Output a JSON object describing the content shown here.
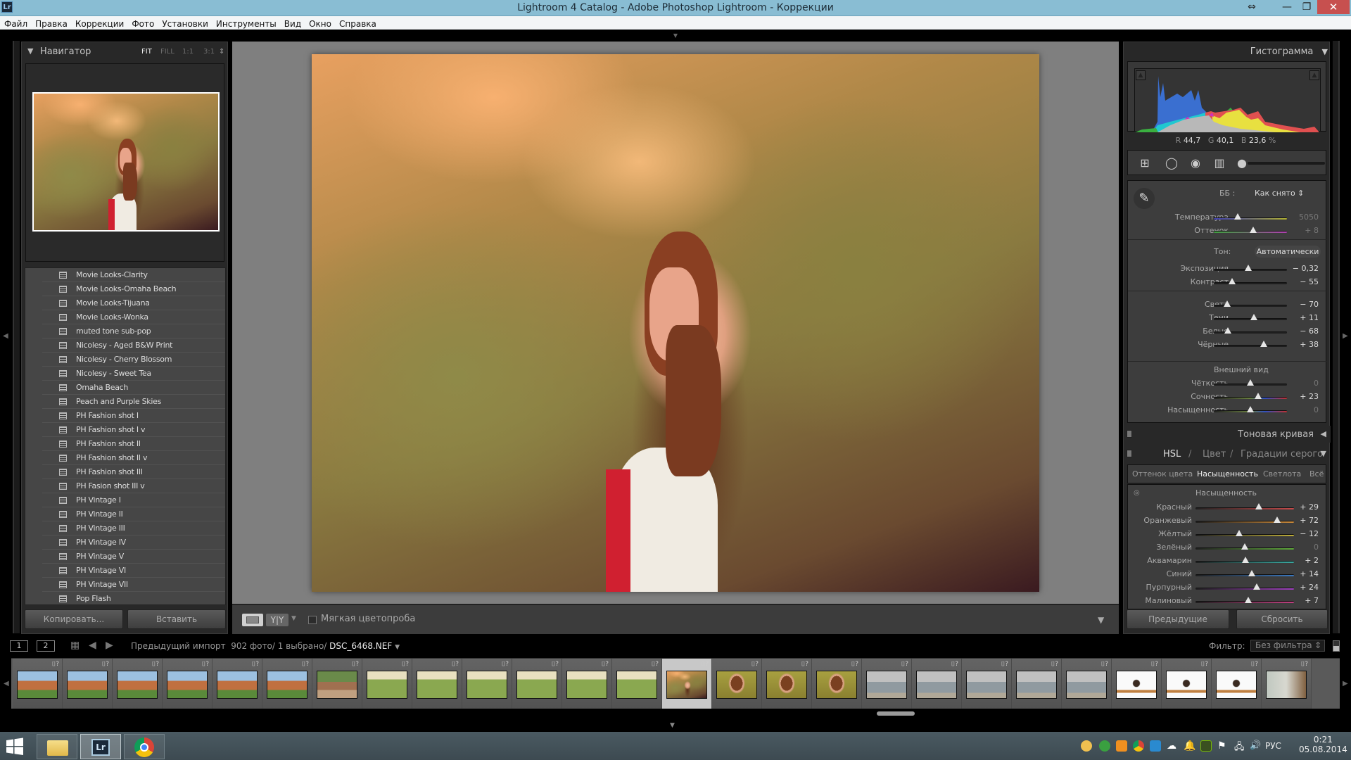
{
  "window": {
    "title": "Lightroom 4 Catalog - Adobe Photoshop Lightroom - Коррекции",
    "app_icon": "Lr",
    "controls": [
      "resize-icon",
      "minimize-icon",
      "maximize-icon",
      "close-icon"
    ],
    "control_glyphs": [
      "⇔",
      "—",
      "❐",
      "✕"
    ]
  },
  "menu": [
    "Файл",
    "Правка",
    "Коррекции",
    "Фото",
    "Установки",
    "Инструменты",
    "Вид",
    "Окно",
    "Справка"
  ],
  "navigator": {
    "title": "Навигатор",
    "zoom_options": [
      "FIT",
      "FILL",
      "1:1",
      "3:1"
    ],
    "active_zoom": "FIT"
  },
  "presets": [
    "Movie Looks-Clarity",
    "Movie Looks-Omaha Beach",
    "Movie Looks-Tijuana",
    "Movie Looks-Wonka",
    "muted tone sub-pop",
    "Nicolesy - Aged B&W Print",
    "Nicolesy - Cherry Blossom",
    "Nicolesy - Sweet Tea",
    "Omaha Beach",
    "Peach and Purple Skies",
    "PH Fashion shot I",
    "PH Fashion shot I v",
    "PH Fashion shot II",
    "PH Fashion shot II v",
    "PH Fashion shot III",
    "PH Fasion shot III v",
    "PH Vintage I",
    "PH Vintage II",
    "PH Vintage III",
    "PH Vintage IV",
    "PH Vintage V",
    "PH Vintage VI",
    "PH Vintage VII",
    "Pop Flash"
  ],
  "left_buttons": {
    "copy": "Копировать...",
    "paste": "Вставить"
  },
  "toolbar": {
    "yy_label": "Y|Y",
    "soft_proof": "Мягкая цветопроба",
    "soft_proof_checked": false
  },
  "histogram": {
    "title": "Гистограмма",
    "r_label": "R",
    "r": "44,7",
    "g_label": "G",
    "g": "40,1",
    "b_label": "B",
    "b": "23,6",
    "unit": "%"
  },
  "tools": [
    "crop-overlay-icon",
    "spot-removal-icon",
    "red-eye-icon",
    "graduated-filter-icon",
    "adjustment-brush-icon"
  ],
  "basic": {
    "wb_label": "ББ :",
    "wb_value": "Как снято ⇕",
    "temp": {
      "label": "Температура",
      "value": "5050",
      "pos": 0.33
    },
    "tint": {
      "label": "Оттенок",
      "value": "+ 8",
      "pos": 0.54
    },
    "tone_label": "Тон:",
    "auto_label": "Автоматически",
    "tone": [
      {
        "label": "Экспозиция",
        "value": "− 0,32",
        "pos": 0.47
      },
      {
        "label": "Контраст",
        "value": "− 55",
        "pos": 0.25
      },
      {
        "label": "Света",
        "value": "− 70",
        "pos": 0.18
      },
      {
        "label": "Тени",
        "value": "+ 11",
        "pos": 0.55
      },
      {
        "label": "Белые",
        "value": "− 68",
        "pos": 0.19
      },
      {
        "label": "Чёрные",
        "value": "+ 38",
        "pos": 0.68
      }
    ],
    "presence_label": "Внешний вид",
    "presence": [
      {
        "label": "Чёткость",
        "value": "0",
        "pos": 0.5
      },
      {
        "label": "Сочность",
        "value": "+ 23",
        "pos": 0.61
      },
      {
        "label": "Насыщенность",
        "value": "0",
        "pos": 0.5
      }
    ]
  },
  "tone_curve": {
    "title": "Тоновая кривая"
  },
  "hsl": {
    "tabs": [
      "HSL",
      "/",
      "Цвет",
      "/",
      "Градации серого"
    ],
    "subtabs": [
      "Оттенок цвета",
      "Насыщенность",
      "Светлота",
      "Всё"
    ],
    "active_subtab": "Насыщенность",
    "section": "Насыщенность",
    "rows": [
      {
        "label": "Красный",
        "value": "+ 29",
        "pos": 0.645,
        "color": "#c84a4a"
      },
      {
        "label": "Оранжевый",
        "value": "+ 72",
        "pos": 0.83,
        "color": "#c8883a"
      },
      {
        "label": "Жёлтый",
        "value": "− 12",
        "pos": 0.44,
        "color": "#bfae3a"
      },
      {
        "label": "Зелёный",
        "value": "0",
        "pos": 0.5,
        "color": "#5ea83a"
      },
      {
        "label": "Аквамарин",
        "value": "+ 2",
        "pos": 0.51,
        "color": "#3aa8a0"
      },
      {
        "label": "Синий",
        "value": "+ 14",
        "pos": 0.57,
        "color": "#3a78c0"
      },
      {
        "label": "Пурпурный",
        "value": "+ 24",
        "pos": 0.62,
        "color": "#a040c0"
      },
      {
        "label": "Малиновый",
        "value": "+ 7",
        "pos": 0.535,
        "color": "#c04080"
      }
    ]
  },
  "right_buttons": {
    "previous": "Предыдущие",
    "reset": "Сбросить"
  },
  "filmstrip": {
    "screen1": "1",
    "screen2": "2",
    "source": "Предыдущий импорт",
    "count": "902 фото/",
    "selected": "1 выбрано/",
    "filename": "DSC_6468.NEF",
    "filter_label": "Фильтр:",
    "filter_value": "Без фильтра",
    "selected_index": 13,
    "thumbs": [
      "group",
      "group",
      "group",
      "group",
      "group",
      "group",
      "camp",
      "field",
      "field",
      "field",
      "field",
      "field",
      "field",
      "portrait",
      "portrait",
      "portrait",
      "portrait",
      "beach",
      "beach",
      "beach",
      "beach",
      "beach",
      "white",
      "white",
      "white",
      "people"
    ]
  },
  "taskbar": {
    "apps": [
      "file-explorer-icon",
      "lightroom-icon",
      "chrome-icon"
    ],
    "lr_label": "Lr",
    "language": "РУС",
    "time": "0:21",
    "date": "05.08.2014"
  }
}
